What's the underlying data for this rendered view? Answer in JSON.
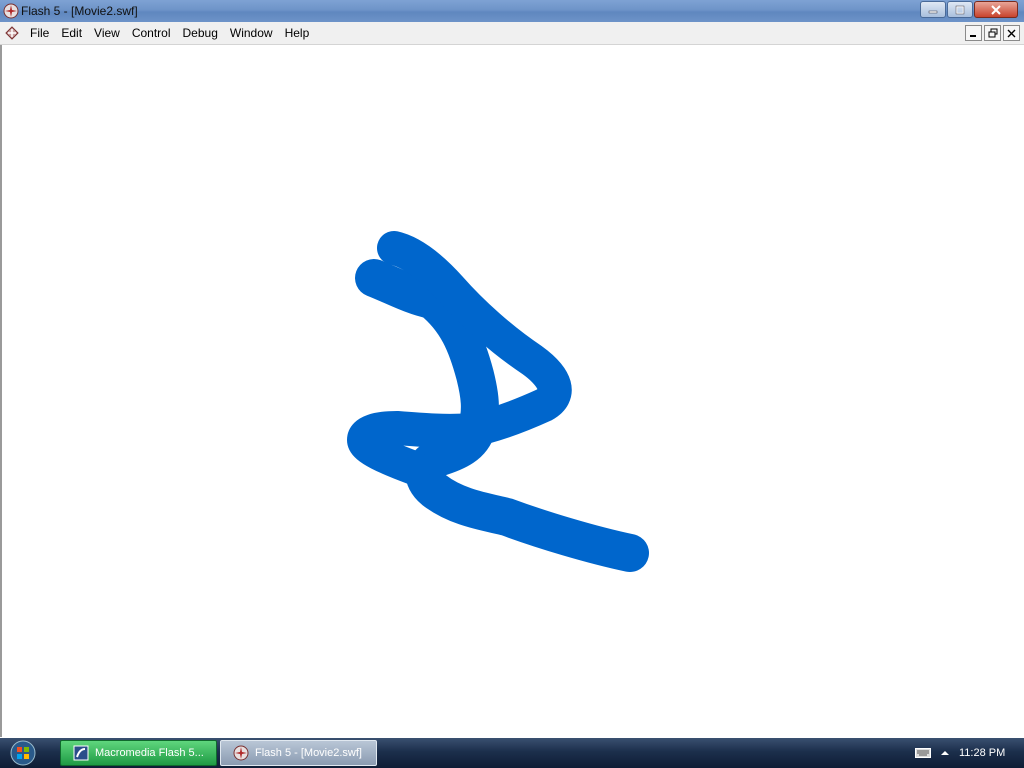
{
  "window": {
    "title": "Flash 5 - [Movie2.swf]"
  },
  "menubar": {
    "items": [
      "File",
      "Edit",
      "View",
      "Control",
      "Debug",
      "Window",
      "Help"
    ]
  },
  "stage": {
    "stroke_color": "#0066cc",
    "background": "#ffffff"
  },
  "taskbar": {
    "buttons": [
      {
        "label": "Macromedia Flash 5...",
        "icon": "flash-doc-icon",
        "state": "flashing"
      },
      {
        "label": "Flash 5 - [Movie2.swf]",
        "icon": "flash-player-icon",
        "state": "active"
      }
    ],
    "clock": "11:28 PM"
  },
  "colors": {
    "titlebar": "#6e94c8",
    "taskbar": "#1c2f4c",
    "stroke": "#0066cc"
  }
}
